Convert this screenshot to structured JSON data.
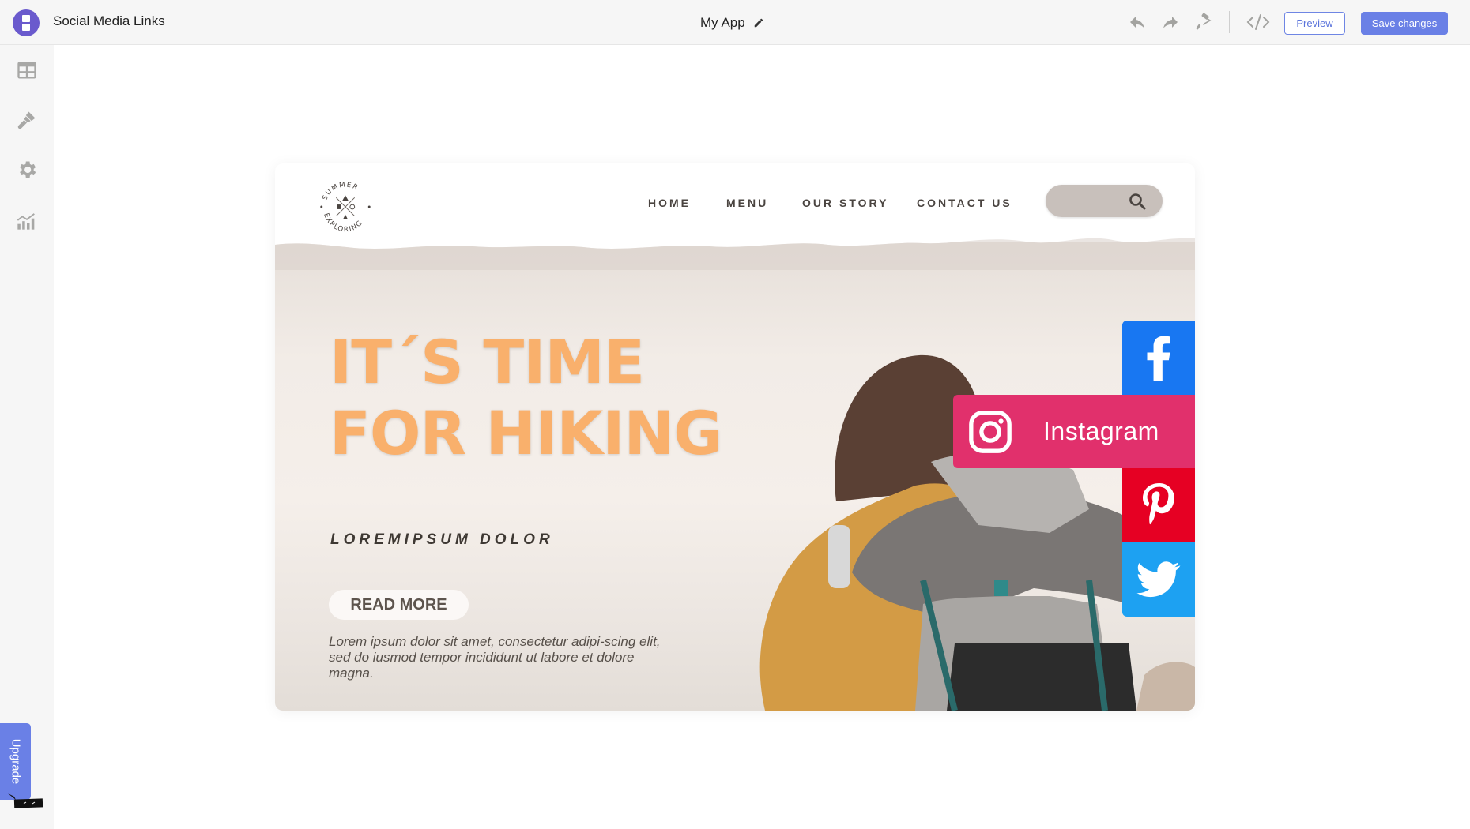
{
  "topbar": {
    "app_title": "Social Media Links",
    "center_title": "My App",
    "icons": [
      "undo-icon",
      "redo-icon",
      "paint-roller-icon",
      "code-icon",
      "pencil-icon"
    ],
    "preview_label": "Preview",
    "save_label": "Save changes"
  },
  "sidebar": {
    "items": [
      {
        "name": "content",
        "icon": "layout-icon"
      },
      {
        "name": "design",
        "icon": "brush-icon"
      },
      {
        "name": "settings",
        "icon": "gear-icon"
      },
      {
        "name": "analytics",
        "icon": "analytics-icon"
      }
    ],
    "upgrade_label": "Upgrade"
  },
  "preview_site": {
    "logo": {
      "top_text": "SUMMER",
      "bottom_text": "EXPLORING"
    },
    "nav": [
      "HOME",
      "MENU",
      "OUR STORY",
      "CONTACT US"
    ],
    "hero_title_line1": "IT´S TIME",
    "hero_title_line2": "FOR HIKING",
    "hero_subtitle": "LOREMIPSUM DOLOR",
    "read_more_label": "READ MORE",
    "body_text": "Lorem ipsum dolor sit amet, consectetur adipi-scing elit, sed do iusmod tempor incididunt ut labore et dolore magna."
  },
  "social_links": [
    {
      "network": "Facebook",
      "color": "#1877f2",
      "expanded": false
    },
    {
      "network": "Instagram",
      "label": "Instagram",
      "color": "#e1306c",
      "expanded": true
    },
    {
      "network": "Pinterest",
      "color": "#e60023",
      "expanded": false
    },
    {
      "network": "Twitter",
      "color": "#1da1f2",
      "expanded": false
    }
  ],
  "colors": {
    "accent": "#6a80e6",
    "app_logo": "#6a5acd",
    "hero_title": "#f9b06c"
  }
}
